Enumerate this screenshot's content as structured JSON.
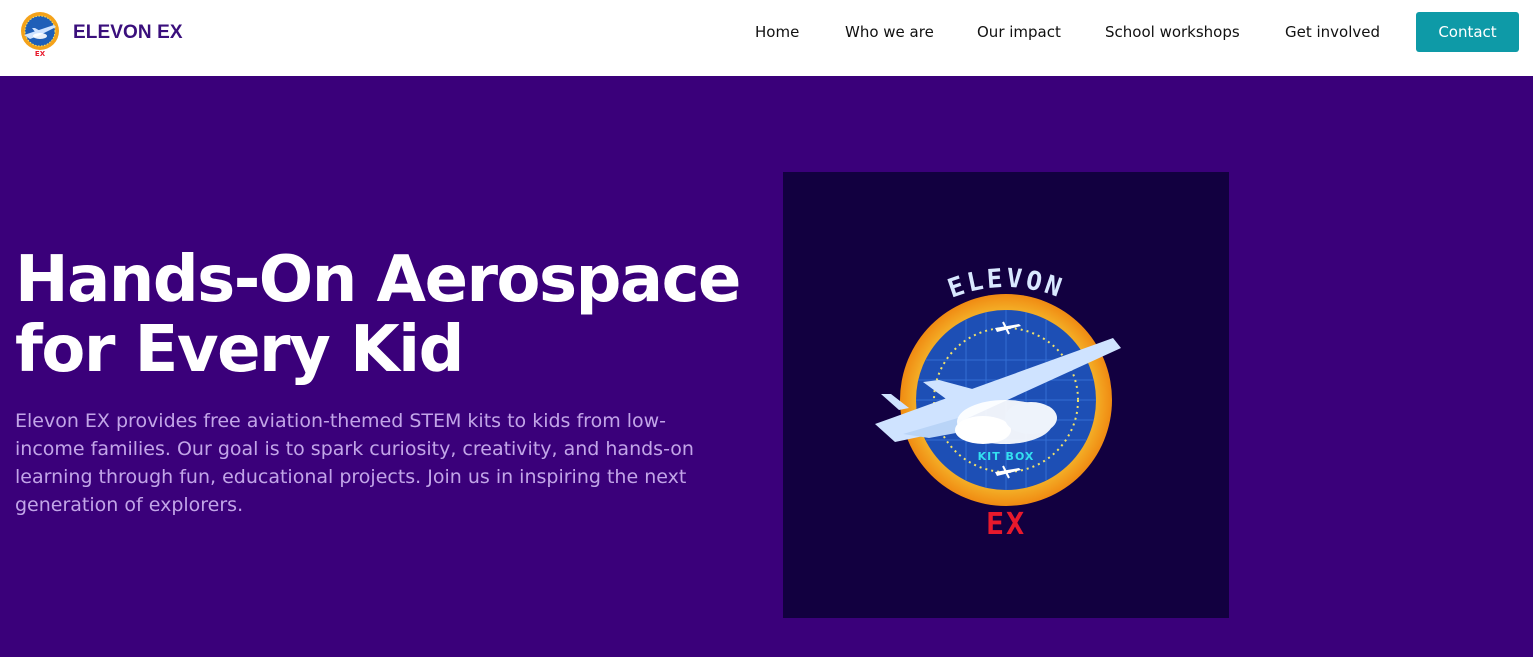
{
  "brand": {
    "name": "ELEVON EX",
    "logo_icon": "airplane-globe-logo-icon"
  },
  "nav": {
    "items": [
      {
        "label": "Home"
      },
      {
        "label": "Who we are"
      },
      {
        "label": "Our impact"
      },
      {
        "label": "School workshops"
      },
      {
        "label": "Get involved"
      }
    ],
    "contact_label": "Contact"
  },
  "hero": {
    "title_line1": "Hands-On Aerospace",
    "title_line2": "for Every Kid",
    "description": "Elevon EX provides free aviation-themed STEM kits to kids from low-income families. Our goal is to spark curiosity, creativity, and hands-on learning through fun, educational projects. Join us in inspiring the next generation of explorers.",
    "image": {
      "icon": "elevon-kit-box-badge-icon",
      "arc_text": "ELEVON",
      "inner_text": "KIT BOX",
      "bottom_text": "EX"
    }
  },
  "colors": {
    "brand_purple": "#3a0f7c",
    "hero_background": "#3a007a",
    "accent_teal": "#0e9aa7",
    "hero_text": "#c2a5e8",
    "image_background": "#120040",
    "ex_red": "#e8192c"
  }
}
